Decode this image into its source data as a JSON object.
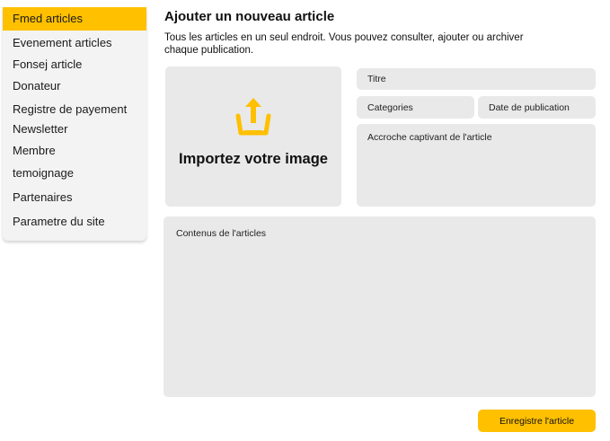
{
  "sidebar": {
    "items": [
      {
        "label": "Fmed articles",
        "active": true
      },
      {
        "label": "Evenement articles",
        "active": false
      },
      {
        "label": "Fonsej article",
        "active": false
      },
      {
        "label": "Donateur",
        "active": false
      },
      {
        "label": "Registre de payement",
        "active": false
      },
      {
        "label": "Newsletter",
        "active": false
      },
      {
        "label": "Membre",
        "active": false
      },
      {
        "label": "temoignage",
        "active": false
      },
      {
        "label": "Partenaires",
        "active": false
      },
      {
        "label": "Parametre du site",
        "active": false
      }
    ]
  },
  "main": {
    "title": "Ajouter un nouveau article",
    "description": "Tous les articles en un seul endroit. Vous pouvez consulter, ajouter ou archiver chaque publication."
  },
  "upload": {
    "label": "Importez votre image",
    "icon": "upload-icon"
  },
  "form": {
    "title_placeholder": "Titre",
    "categories_placeholder": "Categories",
    "date_placeholder": "Date de publication",
    "hook_placeholder": "Accroche captivant de l'article",
    "content_placeholder": "Contenus de l'articles"
  },
  "actions": {
    "save_label": "Enregistre l'article"
  },
  "colors": {
    "accent": "#FFC000",
    "field_bg": "#E9E9E9",
    "sidebar_bg": "#F3F3F3"
  }
}
